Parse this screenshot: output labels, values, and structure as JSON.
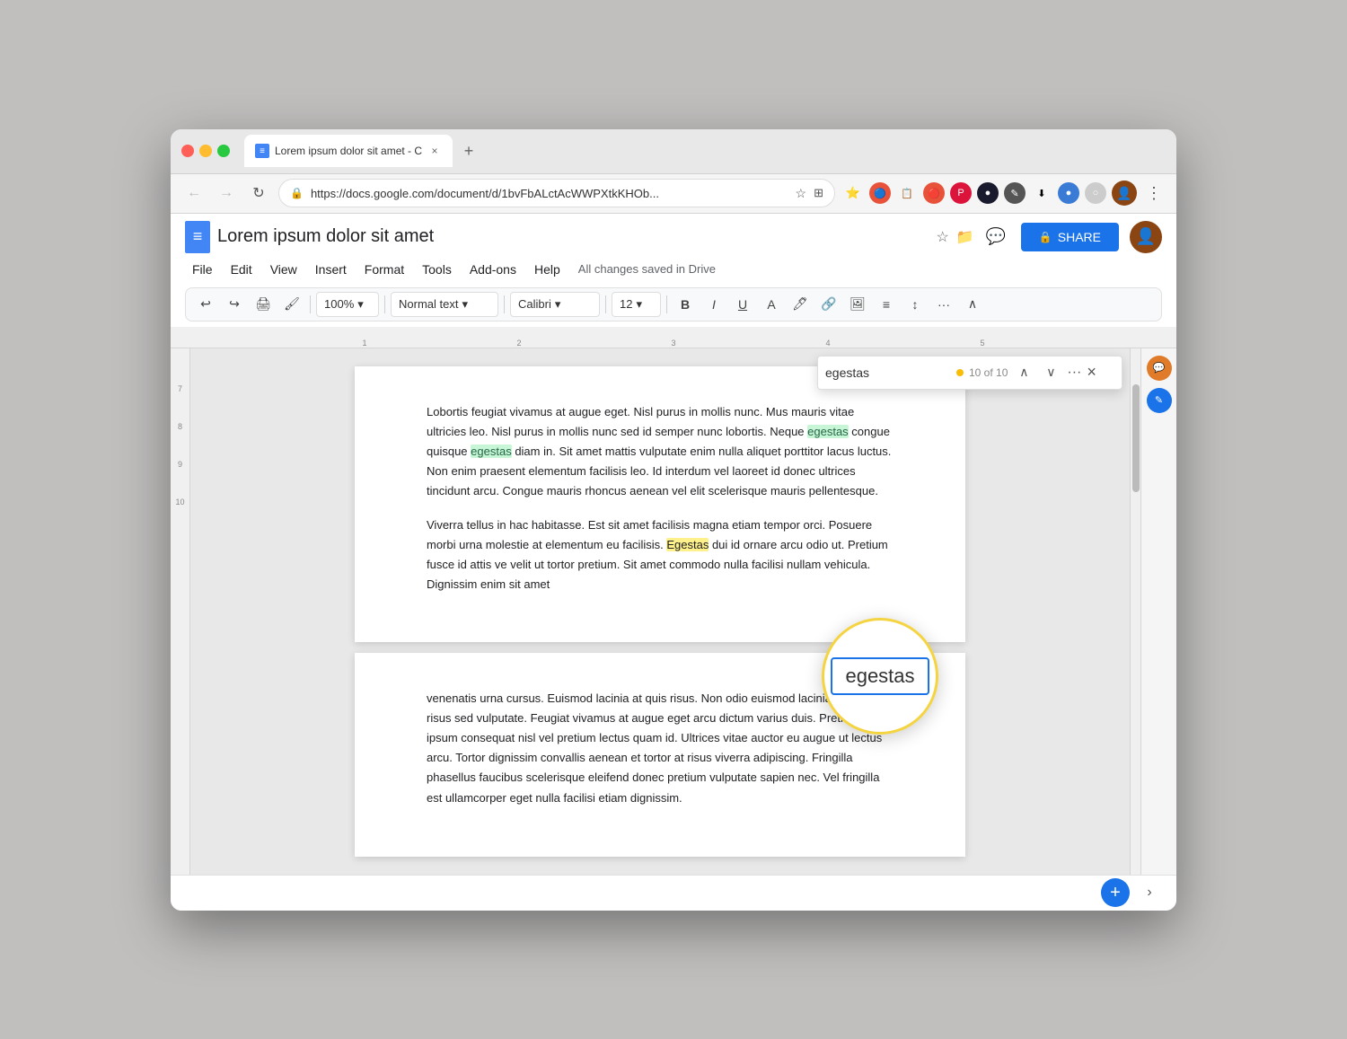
{
  "browser": {
    "tab_title": "Lorem ipsum dolor sit amet - C",
    "url": "https://docs.google.com/document/d/1bvFbALctAcWWPXtkKHOb...",
    "new_tab_label": "+"
  },
  "nav": {
    "back": "←",
    "forward": "→",
    "reload": "↺",
    "lock": "🔒"
  },
  "docs": {
    "title": "Lorem ipsum dolor sit amet",
    "saved_status": "All changes saved in Drive",
    "menu": {
      "file": "File",
      "edit": "Edit",
      "view": "View",
      "insert": "Insert",
      "format": "Format",
      "tools": "Tools",
      "addons": "Add-ons",
      "help": "Help"
    },
    "share_label": "SHARE"
  },
  "toolbar": {
    "undo": "↩",
    "redo": "↪",
    "print": "🖨",
    "paint_format": "🖌",
    "zoom": "100%",
    "style": "Normal text",
    "font": "Calibri",
    "size": "12",
    "bold": "B",
    "italic": "I",
    "underline": "U",
    "more": "···"
  },
  "find_replace": {
    "search_value": "egestas",
    "count_text": "10 of 10",
    "prev": "∧",
    "next": "∨",
    "more_options": "···",
    "close": "×"
  },
  "zoomed_word": {
    "text": "egestas"
  },
  "document": {
    "page1_text": "Lobortis feugiat vivamus at augue eget. Nisl purus in mollis nunc. Mus mauris vitae ultricies leo. Nisl purus in mollis nunc sed id semper nunc lobortis. Neque egestas congue quisque egestas diam in. Sit amet mattis vulputate enim nulla aliquet porttitor lacus luctus. Non enim praesent elementum facilisis leo. Id interdum vel laoreet id donec ultrices tincidunt arcu. Congue mauris rhoncus aenean vel elit scelerisque mauris pellentesque.",
    "page1_para2": "Viverra tellus in hac habitasse. Est sit amet facilisis magna etiam tempor orci. Posuere morbi urna molestie at elementum eu facilisis. Egestas dui id ornare arcu odio ut. Pretium fusce id attis veh velit ut tortor pretium. Sit amet commodo nulla facilisi nullam vehicula. Dignissim enim sit amet",
    "page2_text": "venenatis urna cursus. Euismod lacinia at quis risus. Non odio euismod lacinia at quis risus sed vulputate. Feugiat vivamus at augue eget arcu dictum varius duis. Pretium nibh ipsum consequat nisl vel pretium lectus quam id. Ultrices vitae auctor eu augue ut lectus arcu. Tortor dignissim convallis aenean et tortor at risus viverra adipiscing. Fringilla phasellus faucibus scelerisque eleifend donec pretium vulputate sapien nec. Vel fringilla est ullamcorper eget nulla facilisi etiam dignissim."
  },
  "ruler": {
    "marks": [
      "1",
      "2",
      "3",
      "4",
      "5"
    ]
  },
  "left_ruler_marks": [
    "7",
    "8",
    "9",
    "10"
  ],
  "right_sidebar": {
    "icons": [
      "💬",
      "✏"
    ]
  },
  "bottom_bar": {
    "add_icon": "+",
    "next_icon": "›"
  }
}
